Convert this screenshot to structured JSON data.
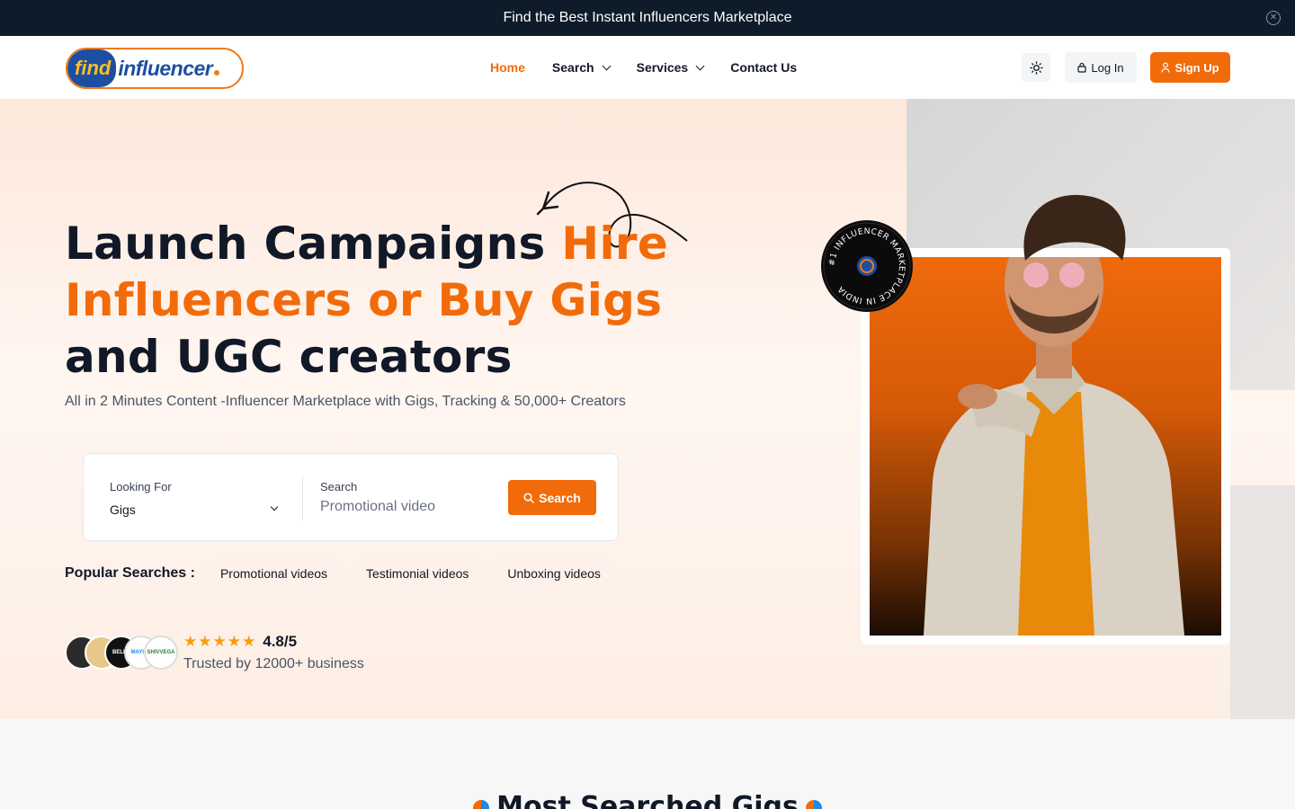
{
  "announcement": {
    "text": "Find the Best Instant Influencers Marketplace"
  },
  "logo": {
    "find": "find",
    "rest": "influencer"
  },
  "nav": {
    "items": [
      {
        "label": "Home"
      },
      {
        "label": "Search"
      },
      {
        "label": "Services"
      },
      {
        "label": "Contact Us"
      }
    ]
  },
  "header": {
    "login_label": "Log In",
    "signup_label": "Sign Up"
  },
  "hero": {
    "title_part1": "Launch Campaigns ",
    "title_accent": "Hire Influencers or Buy Gigs",
    "title_part2": " and UGC creators",
    "subtitle": "All in 2 Minutes Content -Influencer Marketplace with Gigs, Tracking & 50,000+ Creators",
    "badge_text": "#1 INFLUENCER MARKETPLACE IN INDIA"
  },
  "search": {
    "looking_for_label": "Looking For",
    "looking_for_value": "Gigs",
    "search_label": "Search",
    "search_placeholder": "Promotional video",
    "button_label": "Search"
  },
  "popular": {
    "label": "Popular Searches :",
    "chips": [
      "Promotional videos",
      "Testimonial videos",
      "Unboxing videos"
    ]
  },
  "trust": {
    "rating": "4.8/5",
    "stars": 5,
    "text": "Trusted by 12000+ business",
    "avatars": [
      "BELLA",
      "MAYURI",
      "SHIVVEGA"
    ]
  },
  "section2": {
    "title": "Most Searched Gigs"
  },
  "colors": {
    "accent": "#f26b0a",
    "dark": "#0d1b2a",
    "brand_blue": "#1c4fa1"
  }
}
